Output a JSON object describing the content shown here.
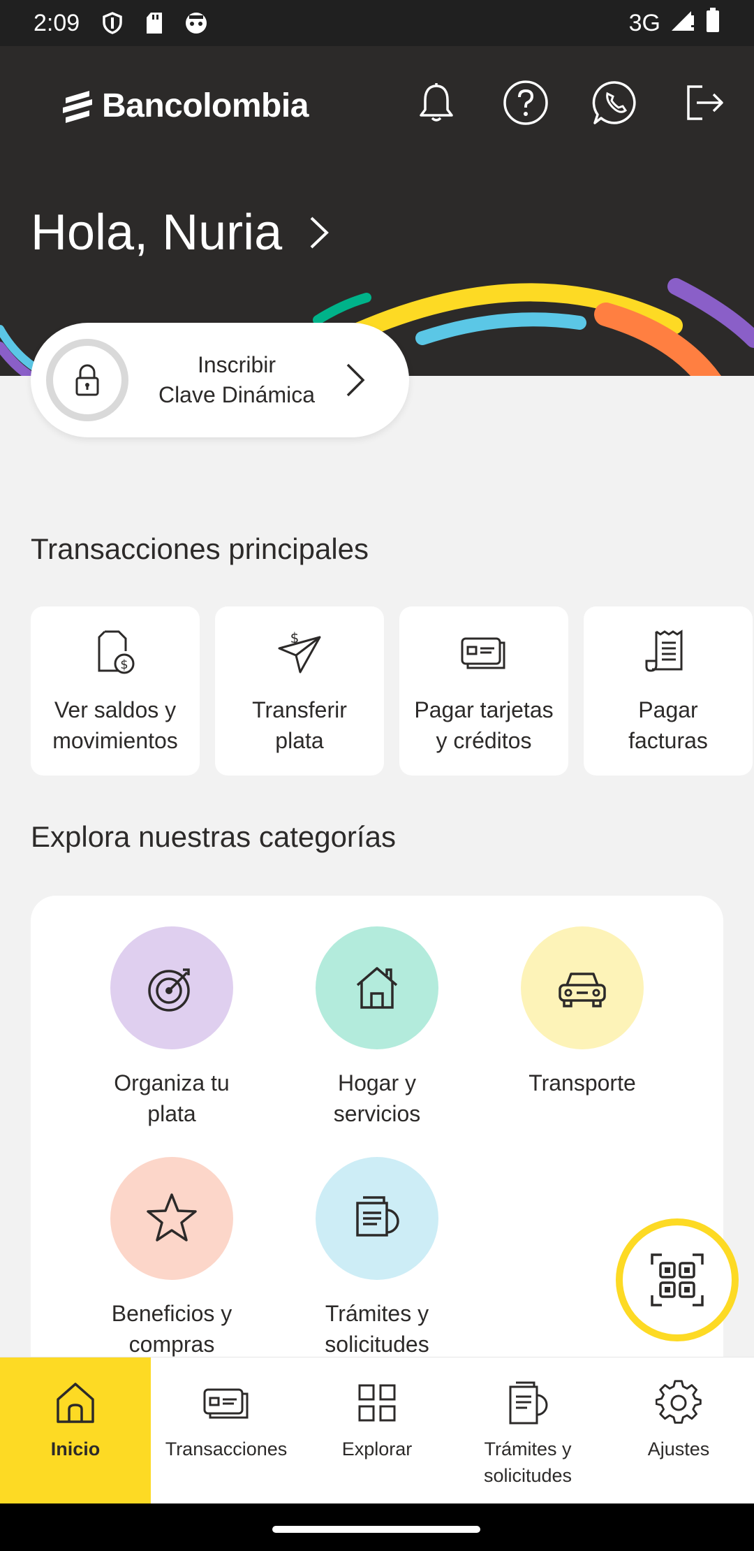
{
  "status_bar": {
    "time": "2:09",
    "network": "3G"
  },
  "header": {
    "brand": "Bancolombia",
    "greeting": "Hola, Nuria",
    "icons": [
      "bell-icon",
      "help-icon",
      "whatsapp-icon",
      "logout-icon"
    ]
  },
  "clave": {
    "line1": "Inscribir",
    "line2": "Clave Dinámica"
  },
  "transactions": {
    "title": "Transacciones principales",
    "items": [
      {
        "line1": "Ver saldos y",
        "line2": "movimientos",
        "icon": "document-money-icon"
      },
      {
        "line1": "Transferir",
        "line2": "plata",
        "icon": "paper-plane-money-icon"
      },
      {
        "line1": "Pagar tarjetas",
        "line2": "y créditos",
        "icon": "cards-icon"
      },
      {
        "line1": "Pagar",
        "line2": "facturas",
        "icon": "invoice-icon"
      }
    ]
  },
  "categories": {
    "title": "Explora nuestras categorías",
    "items": [
      {
        "line1": "Organiza tu",
        "line2": "plata",
        "color": "#dfcfef",
        "icon": "target-icon"
      },
      {
        "line1": "Hogar y",
        "line2": "servicios",
        "color": "#b3ebdc",
        "icon": "house-icon"
      },
      {
        "line1": "Transporte",
        "line2": "",
        "color": "#fdf3b8",
        "icon": "car-icon"
      },
      {
        "line1": "Beneficios y",
        "line2": "compras",
        "color": "#fcd6c9",
        "icon": "star-icon"
      },
      {
        "line1": "Trámites y",
        "line2": "solicitudes",
        "color": "#cdedf6",
        "icon": "documents-icon"
      }
    ]
  },
  "bottom_nav": {
    "items": [
      {
        "line1": "Inicio",
        "line2": "",
        "icon": "home-icon",
        "active": true
      },
      {
        "line1": "Transacciones",
        "line2": "",
        "icon": "cards-icon",
        "active": false
      },
      {
        "line1": "Explorar",
        "line2": "",
        "icon": "grid-icon",
        "active": false
      },
      {
        "line1": "Trámites y",
        "line2": "solicitudes",
        "icon": "documents-icon",
        "active": false
      },
      {
        "line1": "Ajustes",
        "line2": "",
        "icon": "gear-icon",
        "active": false
      }
    ]
  },
  "colors": {
    "accent": "#fdda24",
    "header_bg": "#2c2a29"
  }
}
